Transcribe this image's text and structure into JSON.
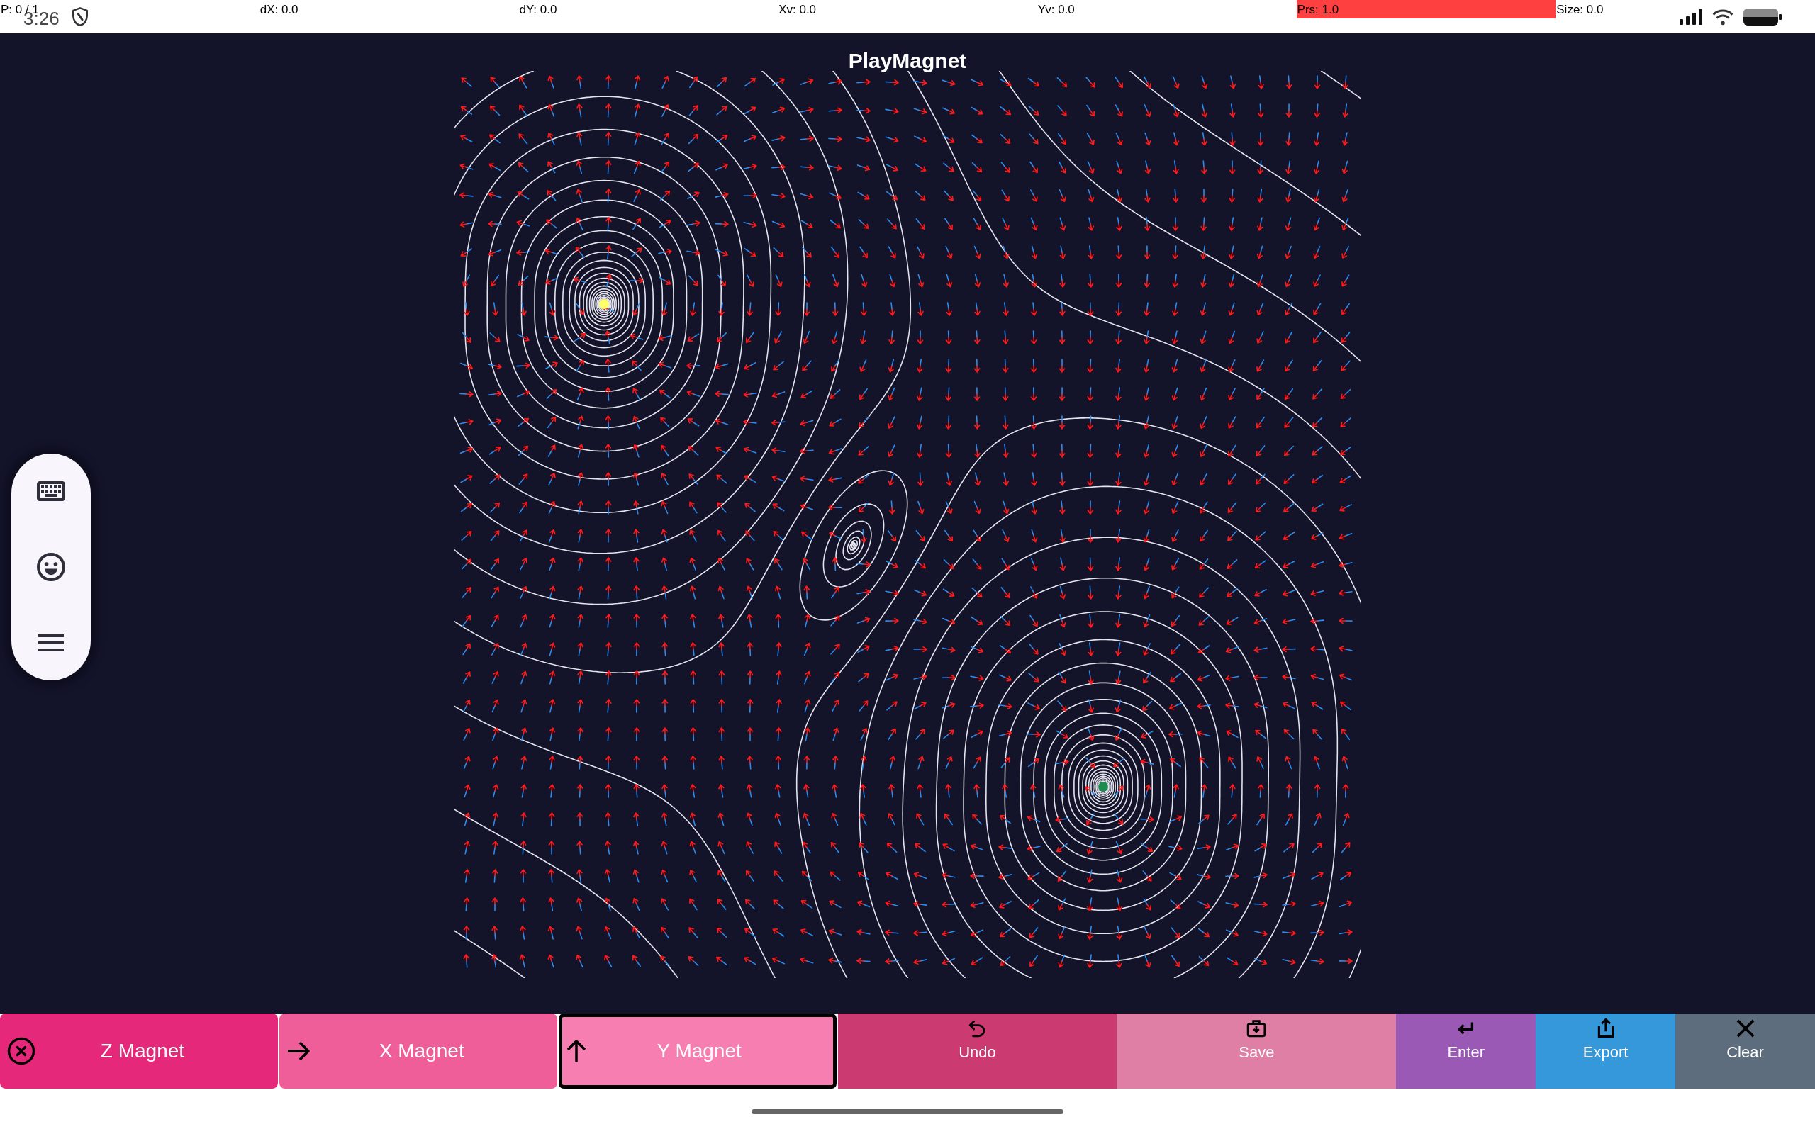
{
  "status_bar": {
    "readouts": [
      {
        "text": "P: 0 / 1",
        "highlighted": false
      },
      {
        "text": "dX: 0.0",
        "highlighted": false
      },
      {
        "text": "dY: 0.0",
        "highlighted": false
      },
      {
        "text": "Xv: 0.0",
        "highlighted": false
      },
      {
        "text": "Yv: 0.0",
        "highlighted": false
      },
      {
        "text": "Prs: 1.0",
        "highlighted": true
      },
      {
        "text": "Size: 0.0",
        "highlighted": false
      }
    ],
    "time": "3:26"
  },
  "title": "PlayMagnet",
  "magnets": [
    {
      "color": "#ffff66"
    },
    {
      "color": "#1e8c4e"
    }
  ],
  "magnet_buttons": [
    {
      "label": "Z Magnet",
      "color": "#e6287a",
      "selected": false
    },
    {
      "label": "X Magnet",
      "color": "#ef5e98",
      "selected": false
    },
    {
      "label": "Y Magnet",
      "color": "#f77eb0",
      "selected": true
    }
  ],
  "action_buttons": [
    {
      "label": "Undo",
      "color": "#cc3a72"
    },
    {
      "label": "Save",
      "color": "#df7fa6"
    },
    {
      "label": "Enter",
      "color": "#9b59b6"
    },
    {
      "label": "Export",
      "color": "#3498db"
    },
    {
      "label": "Clear",
      "color": "#5d6d7e"
    }
  ]
}
